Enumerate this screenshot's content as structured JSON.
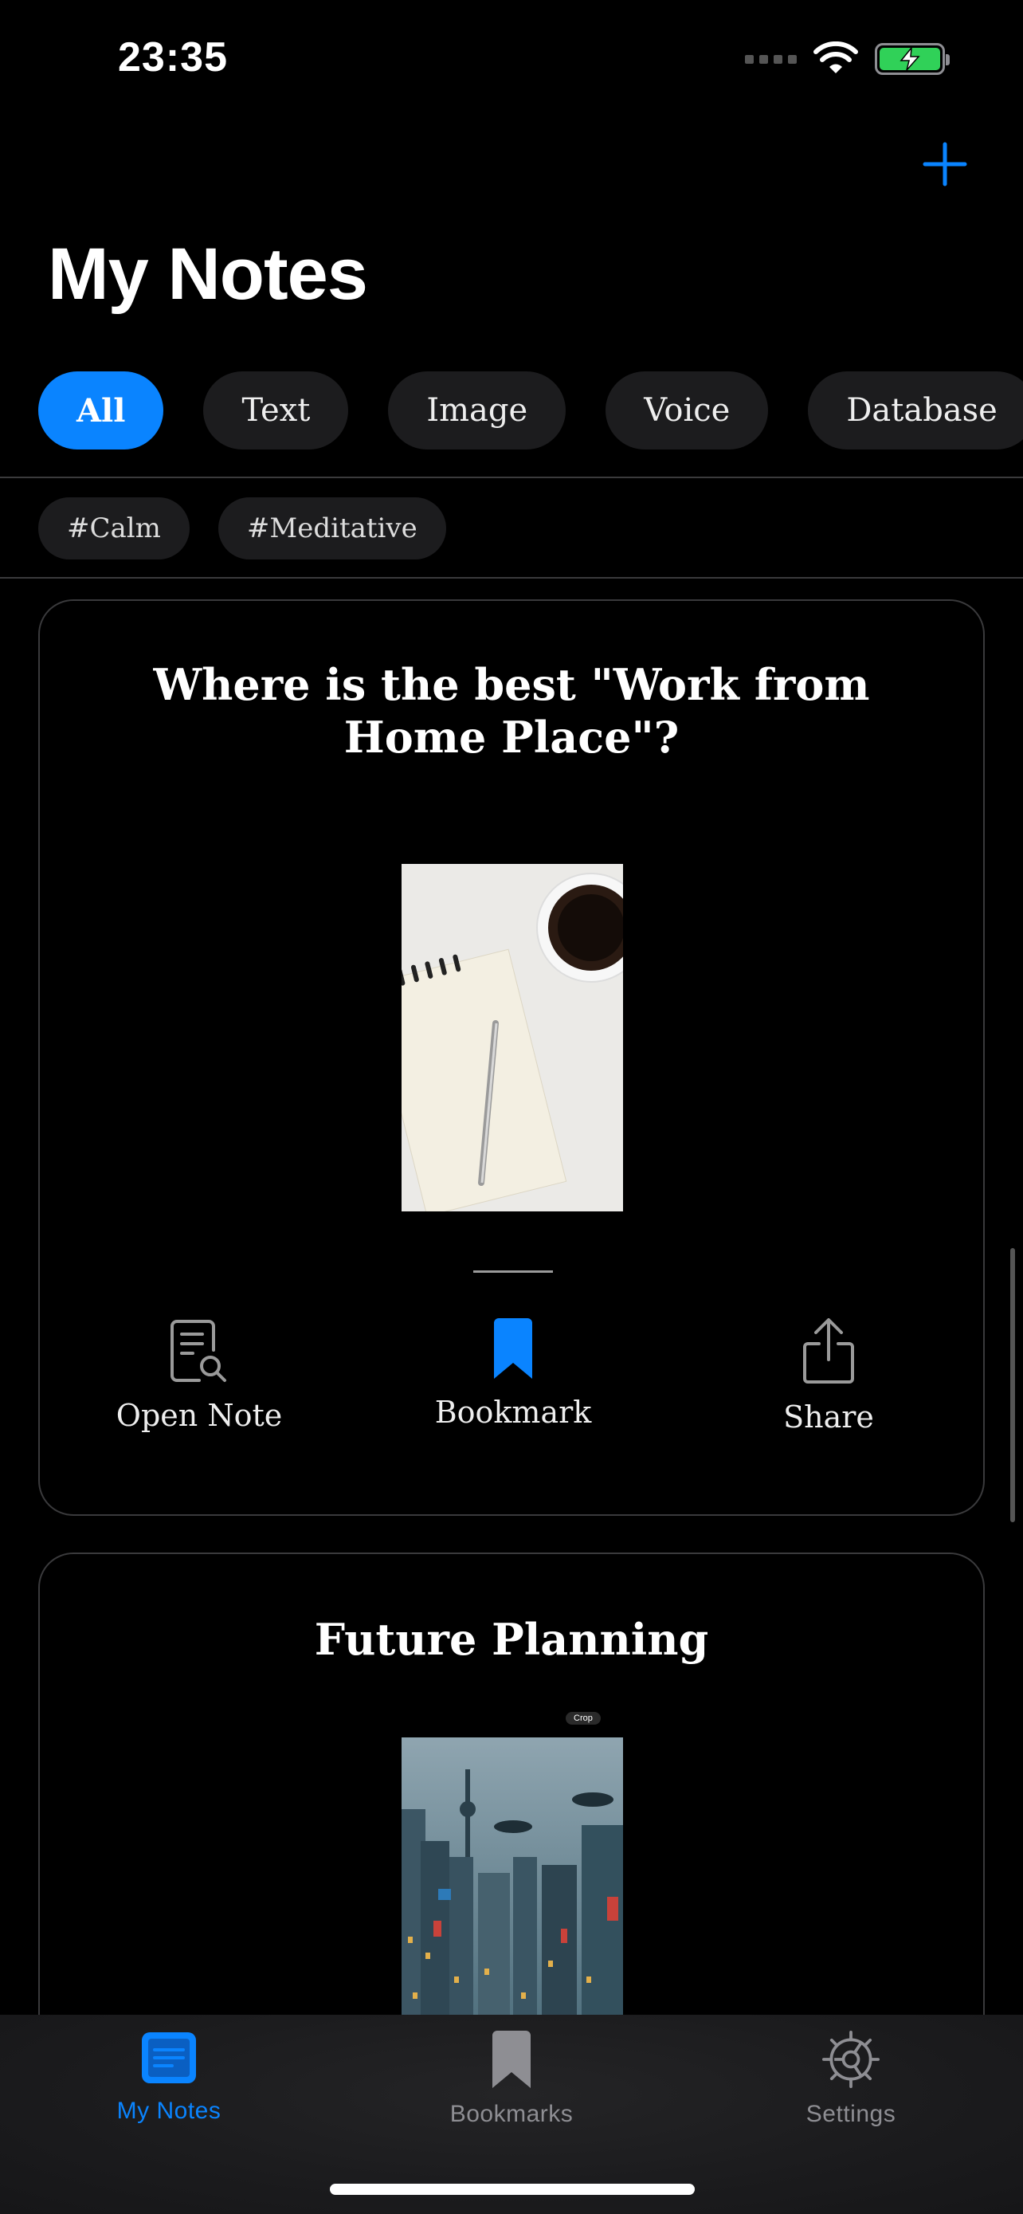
{
  "status_bar": {
    "time": "23:35"
  },
  "header": {
    "title": "My Notes"
  },
  "filters": [
    "All",
    "Text",
    "Image",
    "Voice",
    "Database"
  ],
  "active_filter": "All",
  "tags": [
    "#Calm",
    "#Meditative"
  ],
  "notes": [
    {
      "title": "Where is the best \"Work from Home Place\"?"
    },
    {
      "title": "Future Planning",
      "image_caption": "Crop"
    }
  ],
  "note_actions": {
    "open": "Open Note",
    "bookmark": "Bookmark",
    "share": "Share"
  },
  "tab_bar": {
    "my_notes": "My Notes",
    "bookmarks": "Bookmarks",
    "settings": "Settings",
    "active": "My Notes"
  },
  "colors": {
    "accent": "#0a84ff",
    "battery": "#30d158",
    "chip_bg": "#1c1c1e",
    "card_border": "#3a3a3c"
  }
}
